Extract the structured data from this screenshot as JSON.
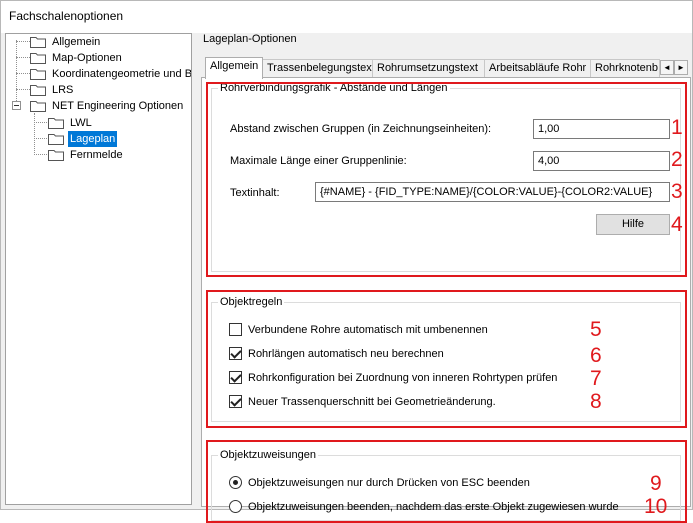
{
  "window": {
    "title": "Fachschalenoptionen"
  },
  "tree": {
    "items": [
      {
        "label": "Allgemein"
      },
      {
        "label": "Map-Optionen"
      },
      {
        "label": "Koordinatengeometrie und Bem"
      },
      {
        "label": "LRS"
      },
      {
        "label": "NET Engineering Optionen"
      },
      {
        "label": "LWL"
      },
      {
        "label": "Lageplan",
        "selected": true
      },
      {
        "label": "Fernmelde"
      }
    ]
  },
  "panel": {
    "title": "Lageplan-Optionen",
    "tabs": [
      {
        "label": "Allgemein",
        "active": true
      },
      {
        "label": "Trassenbelegungstext"
      },
      {
        "label": "Rohrumsetzungstext"
      },
      {
        "label": "Arbeitsabläufe Rohr"
      },
      {
        "label": "Rohrknotenb"
      }
    ],
    "tab_scroll": {
      "left": "◄",
      "right": "►"
    }
  },
  "group1": {
    "title": "Rohrverbindungsgrafik - Abstände und Längen",
    "abstand_label": "Abstand zwischen Gruppen (in Zeichnungseinheiten):",
    "abstand_value": "1,00",
    "laenge_label": "Maximale Länge einer Gruppenlinie:",
    "laenge_value": "4,00",
    "text_label": "Textinhalt:",
    "text_value": "{#NAME} - {FID_TYPE:NAME}/{COLOR:VALUE}-{COLOR2:VALUE}",
    "help_button": "Hilfe"
  },
  "group2": {
    "title": "Objektregeln",
    "checks": [
      {
        "label": "Verbundene Rohre automatisch mit umbenennen",
        "checked": false
      },
      {
        "label": "Rohrlängen automatisch neu berechnen",
        "checked": true
      },
      {
        "label": "Rohrkonfiguration bei Zuordnung von inneren Rohrtypen prüfen",
        "checked": true
      },
      {
        "label": "Neuer Trassenquerschnitt bei Geometrieänderung.",
        "checked": true
      }
    ]
  },
  "group3": {
    "title": "Objektzuweisungen",
    "radios": [
      {
        "label": "Objektzuweisungen nur durch Drücken von ESC beenden",
        "checked": true
      },
      {
        "label": "Objektzuweisungen beenden, nachdem das erste Objekt zugewiesen wurde",
        "checked": false
      }
    ]
  },
  "markers": [
    "1",
    "2",
    "3",
    "4",
    "5",
    "6",
    "7",
    "8",
    "9",
    "10"
  ],
  "colors": {
    "selection": "#0078d7",
    "annotation": "#e0191d"
  }
}
